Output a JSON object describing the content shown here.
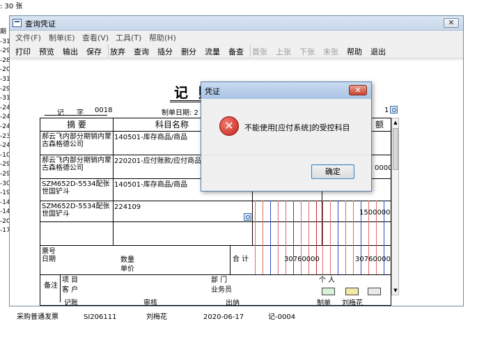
{
  "background": {
    "top_text": ": 30 张",
    "left_labels": [
      "期",
      "-31",
      "-29",
      "-28",
      "-20",
      "-31",
      "-29",
      "-31",
      "-24",
      "-24",
      "-24",
      "-23",
      "-24",
      "-10",
      "-29",
      "-29",
      "-30",
      "-19",
      "-14",
      "-14",
      "-20",
      "-17"
    ],
    "bottom_row": [
      "采购普通发票",
      "SI206111",
      "刘梅花",
      "2020-06-17",
      "记-0004"
    ]
  },
  "window": {
    "title": "查询凭证",
    "close_label": "✕",
    "menu": [
      "文件(F)",
      "制单(E)",
      "查看(V)",
      "工具(T)",
      "帮助(H)"
    ],
    "toolbar": [
      {
        "label": "打印",
        "enabled": true
      },
      {
        "label": "预览",
        "enabled": true
      },
      {
        "label": "输出",
        "enabled": true
      },
      {
        "label": "保存",
        "enabled": true
      },
      {
        "label": "放弃",
        "enabled": true
      },
      {
        "label": "查询",
        "enabled": true
      },
      {
        "label": "插分",
        "enabled": true
      },
      {
        "label": "删分",
        "enabled": true
      },
      {
        "label": "流量",
        "enabled": true
      },
      {
        "label": "备查",
        "enabled": true
      },
      {
        "label": "首张",
        "enabled": false
      },
      {
        "label": "上张",
        "enabled": false
      },
      {
        "label": "下张",
        "enabled": false
      },
      {
        "label": "末张",
        "enabled": false
      },
      {
        "label": "帮助",
        "enabled": true
      },
      {
        "label": "退出",
        "enabled": true
      }
    ]
  },
  "voucher": {
    "title": "记 账",
    "word_label": "记",
    "zi_label": "字",
    "number": "0018",
    "date_label": "制单日期: 2",
    "attach_count": "1",
    "headers": {
      "summary": "摘 要",
      "account": "科目名称",
      "amount_tail": "额"
    },
    "rows": [
      {
        "summary": "郝云飞内部分期销内蒙古森格德公司",
        "account": "140501-库存商品/商品",
        "amount": ""
      },
      {
        "summary": "郝云飞内部分期销内蒙古森格德公司",
        "account": "220201-应付账款/应付商品",
        "amount": "0000"
      },
      {
        "summary": "SZM652D-5534配张世国铲斗",
        "account": "140501-库存商品/商品",
        "amount": ""
      },
      {
        "summary": "SZM652D-5534配张世国铲斗",
        "account": "224109",
        "amount": "1500000"
      }
    ],
    "footer": {
      "ticket_no": "票号",
      "date": "日期",
      "qty": "数量",
      "unit_price": "单价",
      "total_label": "合 计",
      "debit_total": "30760000",
      "credit_total": "30760000",
      "remarks": "备注",
      "project": "项 目",
      "customer": "客 户",
      "department": "部 门",
      "salesperson": "业务员",
      "person": "个 人"
    },
    "signatures": {
      "bookkeeper": "记账",
      "reviewer": "审核",
      "cashier": "出纳",
      "maker_label": "制单",
      "maker_name": "刘梅花"
    }
  },
  "dialog": {
    "title": "凭证",
    "close_label": "✕",
    "message": "不能使用[应付系统]的受控科目",
    "ok_label": "确定"
  }
}
